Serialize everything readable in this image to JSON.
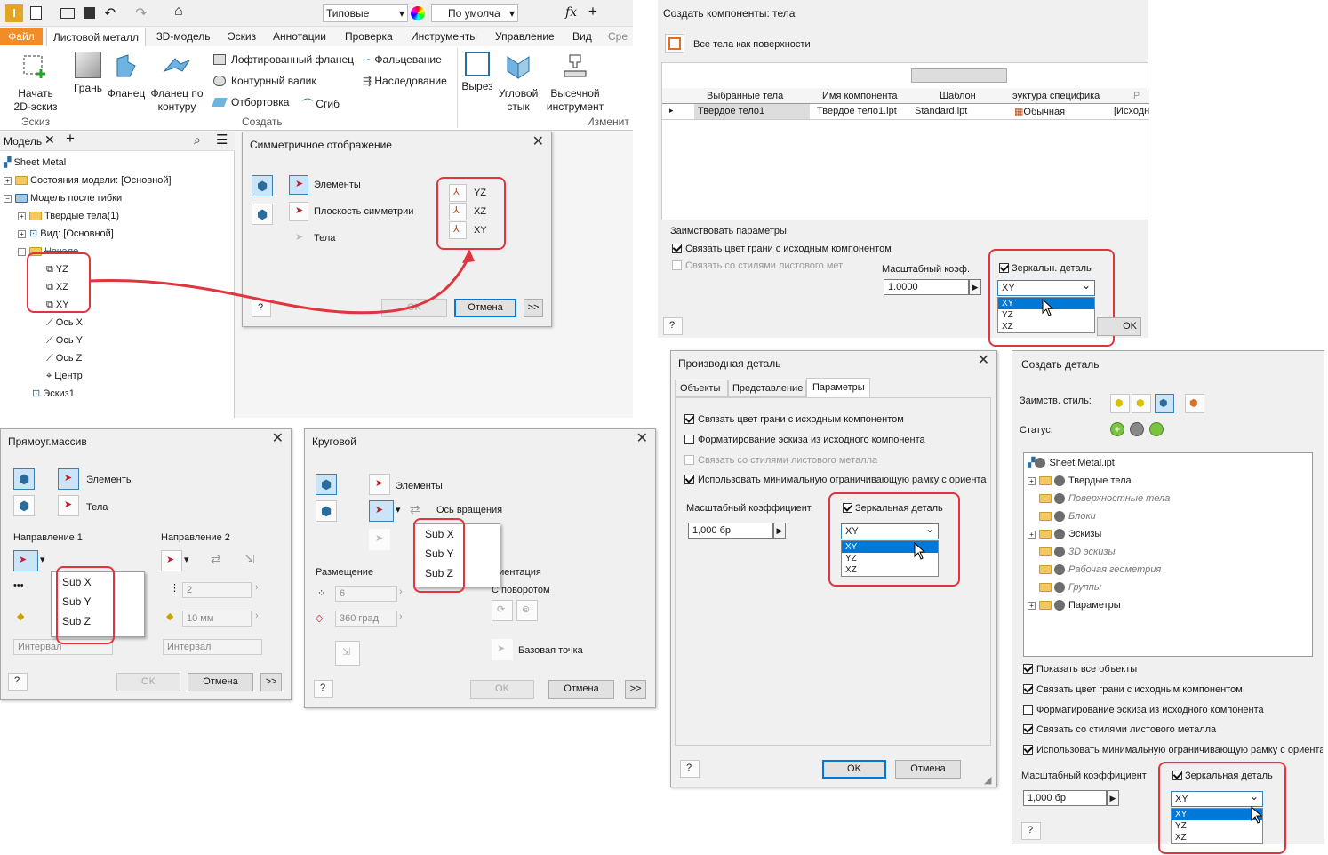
{
  "toolbar": {
    "style_value": "Типовые",
    "color_value": "По умолча",
    "fx": "fx"
  },
  "ribbon": {
    "tabs": [
      "Файл",
      "Листовой металл",
      "3D-модель",
      "Эскиз",
      "Аннотации",
      "Проверка",
      "Инструменты",
      "Управление",
      "Вид",
      "Сре"
    ],
    "start_sketch": "Начать 2D-эскиз",
    "sketch_group": "Эскиз",
    "create_group": "Создать",
    "modify_group": "Изменит",
    "face": "Грань",
    "flange": "Фланец",
    "contour_flange": "Фланец по контуру",
    "lofted_flange": "Лофтированный фланец",
    "contour_roll": "Контурный валик",
    "hem": "Отбортовка",
    "fold": "Фальцевание",
    "derive": "Наследование",
    "bend": "Сгиб",
    "cut": "Вырез",
    "corner_seam": "Угловой стык",
    "punch_tool": "Высечной инструмент"
  },
  "browser": {
    "tab": "Модель",
    "items": [
      "Sheet Metal",
      "Состояния модели: [Основной]",
      "Модель после гибки",
      "Твердые тела(1)",
      "Вид: [Основной]",
      "Начало",
      "YZ",
      "XZ",
      "XY",
      "Ось X",
      "Ось Y",
      "Ось Z",
      "Центр",
      "Эскиз1"
    ]
  },
  "mirror_dialog": {
    "title": "Симметричное отображение",
    "features": "Элементы",
    "mirror_plane": "Плоскость симметрии",
    "bodies": "Тела",
    "planes": [
      "YZ",
      "XZ",
      "XY"
    ],
    "ok": "OK",
    "cancel": "Отмена",
    "more": ">>"
  },
  "make_components": {
    "title": "Создать компоненты: тела",
    "all_bodies": "Все тела как поверхности",
    "headers": [
      "Выбранные тела",
      "Имя компонента",
      "Шаблон",
      "эуктура специфика",
      "Р"
    ],
    "row": [
      "Твердое тело1",
      "Твердое тело1.ipt",
      "Standard.ipt",
      "Обычная",
      "[Исходны"
    ],
    "borrow": "Заимствовать параметры",
    "link_color": "Связать цвет грани с исходным компонентом",
    "link_styles": "Связать со стилями листового мет",
    "scale_label": "Масштабный коэф.",
    "scale_value": "1.0000",
    "mirror": "Зеркальн. деталь",
    "mirror_value": "XY",
    "options": [
      "XY",
      "YZ",
      "XZ"
    ],
    "ok": "OK"
  },
  "rect_pattern": {
    "title": "Прямоуг.массив",
    "features": "Элементы",
    "bodies": "Тела",
    "dir1": "Направление 1",
    "dir2": "Направление 2",
    "count": "2",
    "spacing": "10 мм",
    "interval": "Интервал",
    "subs": [
      "Sub X",
      "Sub Y",
      "Sub Z"
    ],
    "ok": "OK",
    "cancel": "Отмена",
    "more": ">>"
  },
  "circ_pattern": {
    "title": "Круговой",
    "features": "Элементы",
    "axis": "Ось вращения",
    "placement": "Размещение",
    "orientation": "риентация",
    "rotation": "С поворотом",
    "count": "6",
    "angle": "360 град",
    "base_point": "Базовая точка",
    "subs": [
      "Sub X",
      "Sub Y",
      "Sub Z"
    ],
    "ok": "OK",
    "cancel": "Отмена",
    "more": ">>"
  },
  "derived_part": {
    "title": "Производная деталь",
    "tabs": [
      "Объекты",
      "Представление",
      "Параметры"
    ],
    "options": [
      "Связать цвет грани с исходным компонентом",
      "Форматирование эскиза из исходного компонента",
      "Связать со стилями листового металла",
      "Использовать минимальную ограничивающую рамку с ориента"
    ],
    "scale_label": "Масштабный коэффициент",
    "scale_value": "1,000 бр",
    "mirror": "Зеркальная деталь",
    "mirror_value": "XY",
    "planes": [
      "XY",
      "YZ",
      "XZ"
    ],
    "ok": "OK",
    "cancel": "Отмена"
  },
  "create_part": {
    "title": "Создать деталь",
    "borrow_style": "Заимств. стиль:",
    "status": "Статус:",
    "tree": [
      "Sheet Metal.ipt",
      "Твердые тела",
      "Поверхностные тела",
      "Блоки",
      "Эскизы",
      "3D эскизы",
      "Рабочая геометрия",
      "Группы",
      "Параметры"
    ],
    "options": [
      "Показать все объекты",
      "Связать цвет грани с исходным компонентом",
      "Форматирование эскиза из исходного компонента",
      "Связать со стилями листового металла",
      "Использовать минимальную ограничивающую рамку с ориента"
    ],
    "scale_label": "Масштабный коэффициент",
    "scale_value": "1,000 бр",
    "mirror": "Зеркальная деталь",
    "mirror_value": "XY",
    "planes": [
      "XY",
      "YZ",
      "XZ"
    ]
  },
  "colors": {
    "accent": "#0078d7",
    "highlight": "#e0353f",
    "file_tab": "#f28c28"
  }
}
